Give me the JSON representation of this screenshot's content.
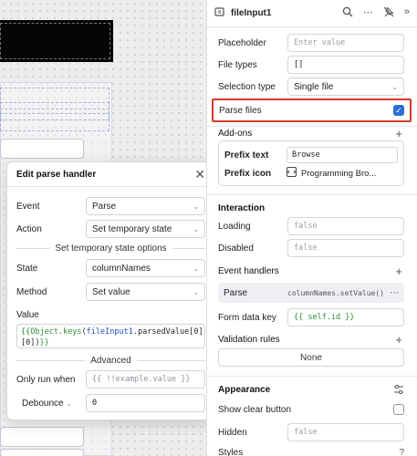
{
  "popover": {
    "title": "Edit parse handler",
    "event_label": "Event",
    "event_value": "Parse",
    "action_label": "Action",
    "action_value": "Set temporary state",
    "state_options_divider": "Set temporary state options",
    "state_label": "State",
    "state_value": "columnNames",
    "method_label": "Method",
    "method_value": "Set value",
    "value_label": "Value",
    "value_code": {
      "open": "{{",
      "fn": "Object.keys",
      "paren_open": "(",
      "ident": "fileInput1",
      "rest": ".parsedValue[0]",
      "line2": "[0])",
      "close": "}}"
    },
    "advanced_divider": "Advanced",
    "only_run_label": "Only run when",
    "only_run_placeholder": "{{ !!example.value }}",
    "debounce_label": "Debounce",
    "debounce_value": "0"
  },
  "inspector": {
    "title": "fileInput1",
    "placeholder_label": "Placeholder",
    "placeholder_value": "Enter value",
    "file_types_label": "File types",
    "file_types_value": "[]",
    "selection_type_label": "Selection type",
    "selection_type_value": "Single file",
    "parse_files_label": "Parse files",
    "parse_files_checked": true,
    "addons_title": "Add-ons",
    "prefix_text_label": "Prefix text",
    "prefix_text_value": "Browse",
    "prefix_icon_label": "Prefix icon",
    "prefix_icon_value": "Programming Bro...",
    "interaction_title": "Interaction",
    "loading_label": "Loading",
    "loading_value": "false",
    "disabled_label": "Disabled",
    "disabled_value": "false",
    "event_handlers_label": "Event handlers",
    "handler_event": "Parse",
    "handler_action": "columnNames.setValue()",
    "form_data_key_label": "Form data key",
    "form_data_key_value": "{{ self.id }}",
    "validation_rules_label": "Validation rules",
    "validation_rules_value": "None",
    "appearance_title": "Appearance",
    "show_clear_label": "Show clear button",
    "hidden_label": "Hidden",
    "hidden_value": "false",
    "styles_label": "Styles"
  },
  "colors": {
    "accent": "#2b6fd6",
    "highlight_border": "#d63a2c",
    "code_green": "#2f8f3a",
    "code_blue": "#1f4fbf"
  },
  "icons": [
    "component-icon",
    "search-icon",
    "more-icon",
    "pin-icon",
    "expand-icon",
    "close-icon",
    "plus-icon",
    "chevron-down-icon",
    "check-icon",
    "code-icon",
    "settings-sliders-icon",
    "help-icon"
  ]
}
